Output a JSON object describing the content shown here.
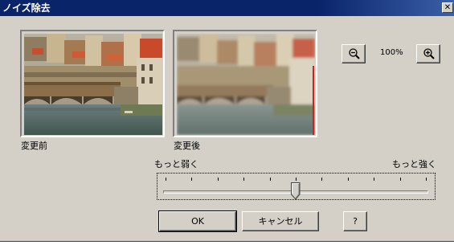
{
  "window": {
    "title": "ノイズ除去",
    "close_symbol": "✕"
  },
  "previews": {
    "before_label": "変更前",
    "after_label": "変更後"
  },
  "zoom": {
    "level": "100%",
    "out_icon": "zoom-out-magnifier-icon",
    "in_icon": "zoom-in-magnifier-icon"
  },
  "strength_slider": {
    "min_label": "もっと弱く",
    "max_label": "もっと強く",
    "tick_count": 11,
    "value_fraction": 0.5
  },
  "buttons": {
    "ok": "OK",
    "cancel": "キャンセル",
    "help": "?"
  },
  "colors": {
    "titlebar": "#0a246a",
    "dialog_face": "#d4d0c8"
  }
}
